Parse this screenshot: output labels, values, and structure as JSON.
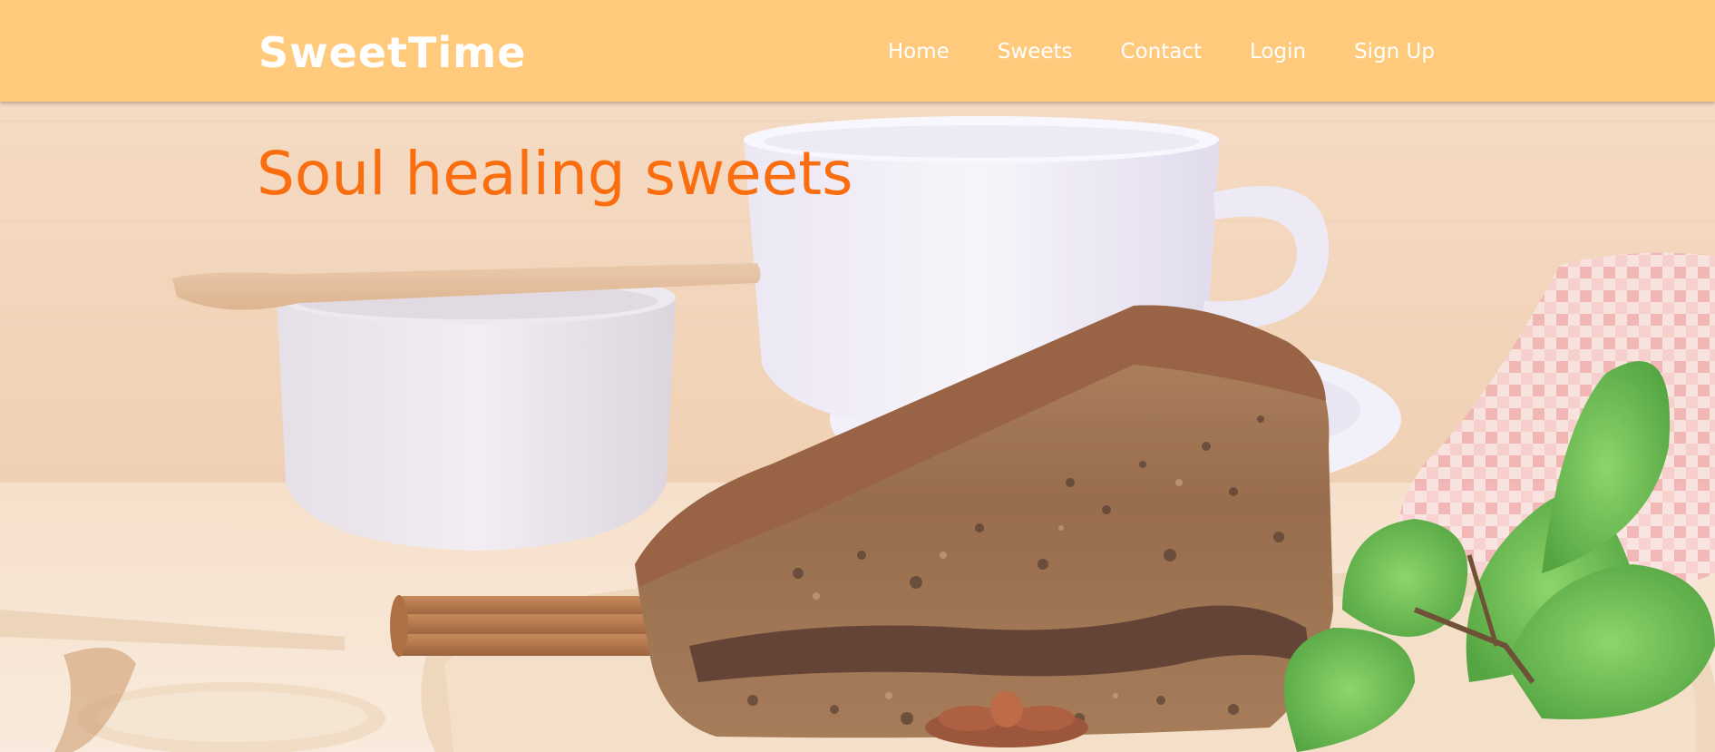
{
  "header": {
    "brand": "SweetTime",
    "nav": [
      {
        "label": "Home"
      },
      {
        "label": "Sweets"
      },
      {
        "label": "Contact"
      },
      {
        "label": "Login"
      },
      {
        "label": "Sign Up"
      }
    ]
  },
  "hero": {
    "title": "Soul healing sweets"
  },
  "colors": {
    "header_background": "#ffca7c",
    "header_text": "#ffffff",
    "hero_title": "#fb6e10"
  }
}
